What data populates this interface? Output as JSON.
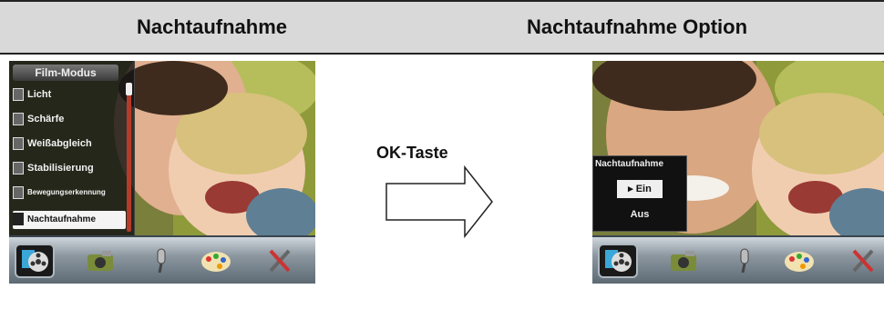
{
  "header": {
    "left_title": "Nachtaufnahme",
    "right_title": "Nachtaufnahme Option"
  },
  "left_screen": {
    "menu_title": "Film-Modus",
    "menu_items": [
      {
        "label": "Licht",
        "icon": "light-icon"
      },
      {
        "label": "Schärfe",
        "icon": "sharpness-icon"
      },
      {
        "label": "Weißabgleich",
        "icon": "white-balance-icon"
      },
      {
        "label": "Stabilisierung",
        "icon": "stabilization-icon"
      },
      {
        "label": "Bewegungserkennung",
        "icon": "motion-detect-icon"
      },
      {
        "label": "Nachtaufnahme",
        "icon": "night-mode-icon",
        "selected": true
      }
    ]
  },
  "arrow": {
    "label": "OK-Taste"
  },
  "right_screen": {
    "popup_title": "Nachtaufnahme",
    "options": [
      {
        "label": "▸ Ein",
        "selected": true
      },
      {
        "label": "Aus",
        "selected": false
      }
    ]
  },
  "dock_icons": [
    "film-reel-icon",
    "photo-camera-icon",
    "microphone-icon",
    "palette-icon",
    "settings-tools-icon"
  ],
  "colors": {
    "header_bg": "#d9d9d9",
    "menu_bg": "#1a1a1a",
    "scrollbar": "#b53b2a"
  }
}
